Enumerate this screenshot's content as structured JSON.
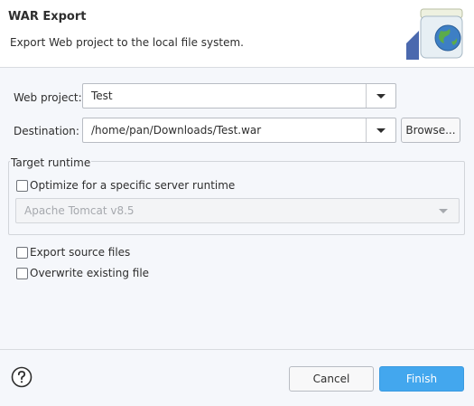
{
  "header": {
    "title": "WAR Export",
    "description": "Export Web project to the local file system."
  },
  "form": {
    "web_project_label": "Web project:",
    "web_project_value": "Test",
    "destination_label": "Destination:",
    "destination_value": "/home/pan/Downloads/Test.war",
    "browse_label": "Browse..."
  },
  "target_runtime": {
    "group_title": "Target runtime",
    "optimize_label": "Optimize for a specific server runtime",
    "optimize_checked": false,
    "runtime_value": "Apache Tomcat v8.5"
  },
  "options": {
    "export_source_label": "Export source files",
    "export_source_checked": false,
    "overwrite_label": "Overwrite existing file",
    "overwrite_checked": false
  },
  "footer": {
    "cancel_label": "Cancel",
    "finish_label": "Finish"
  },
  "icons": {
    "banner": "jar-globe-icon",
    "help": "help-icon",
    "dropdown": "chevron-down-icon"
  },
  "colors": {
    "primary": "#43a7ee",
    "header_bg": "#ffffff",
    "body_bg": "#f5f7fb"
  }
}
